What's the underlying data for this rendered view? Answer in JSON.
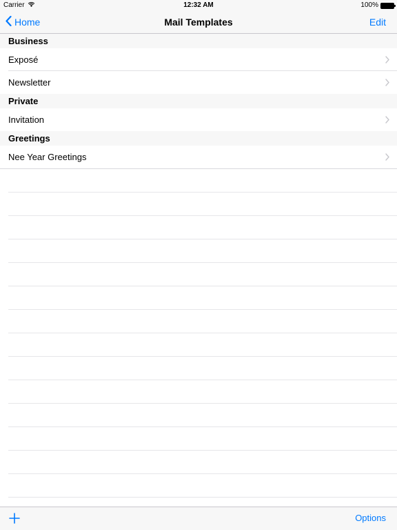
{
  "status_bar": {
    "carrier": "Carrier",
    "time": "12:32 AM",
    "battery_percent": "100%",
    "battery_level": 1.0
  },
  "nav": {
    "back_label": "Home",
    "title": "Mail Templates",
    "edit_label": "Edit"
  },
  "sections": [
    {
      "header": "Business",
      "items": [
        {
          "label": "Exposé"
        },
        {
          "label": "Newsletter"
        }
      ]
    },
    {
      "header": "Private",
      "items": [
        {
          "label": "Invitation"
        }
      ]
    },
    {
      "header": "Greetings",
      "items": [
        {
          "label": "Nee Year Greetings"
        }
      ]
    }
  ],
  "toolbar": {
    "add_icon": "plus-icon",
    "options_label": "Options"
  },
  "colors": {
    "accent": "#007aff",
    "bar_background": "#f7f7f7",
    "separator": "#c8c7cc"
  }
}
